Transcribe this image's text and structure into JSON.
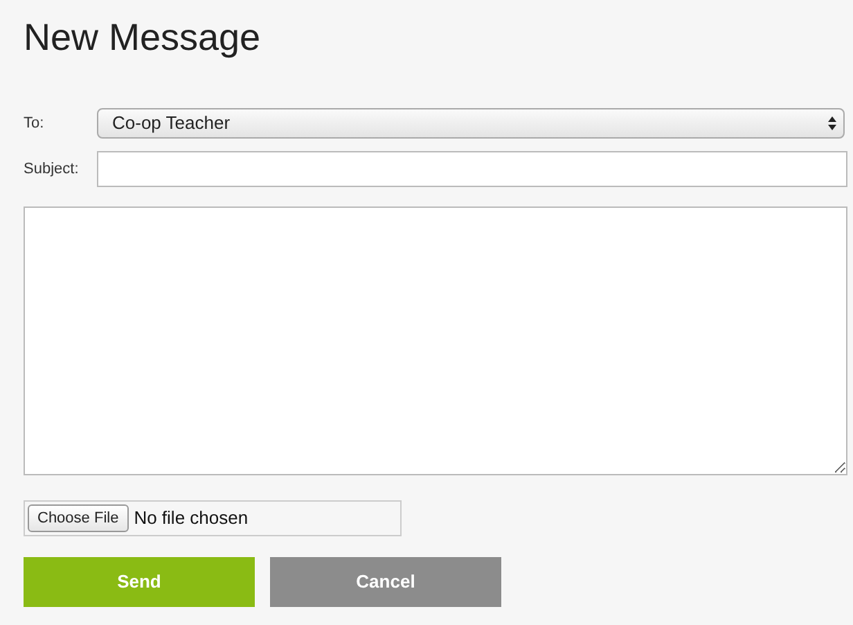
{
  "title": "New Message",
  "to": {
    "label": "To:",
    "value": "Co-op Teacher"
  },
  "subject": {
    "label": "Subject:"
  },
  "attachment": {
    "button": "Choose File",
    "status": "No file chosen"
  },
  "buttons": [
    {
      "label": "Send",
      "kind": "primary"
    },
    {
      "label": "Cancel",
      "kind": "secondary"
    }
  ]
}
